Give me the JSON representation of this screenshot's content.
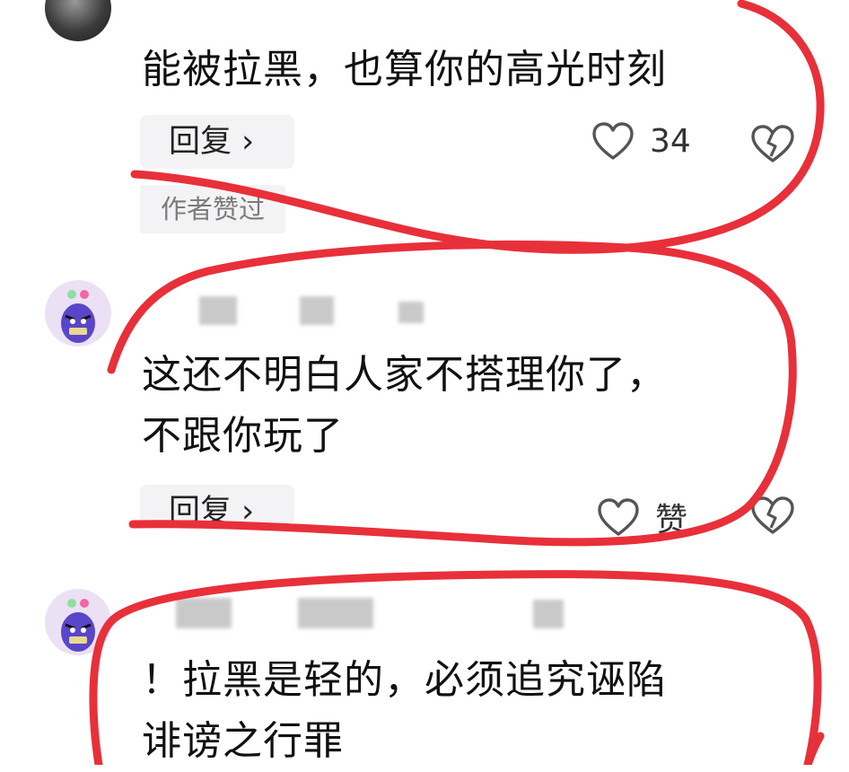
{
  "comments": [
    {
      "text_lines": [
        "能被拉黑，也算你的高光时刻"
      ],
      "reply_label": "回复 ›",
      "like_count": "34",
      "author_badge": "作者赞过"
    },
    {
      "username_partial": "",
      "text_lines": [
        "这还不明白人家不搭理你了，",
        "不跟你玩了"
      ],
      "reply_label": "回复 ›",
      "like_label": "赞"
    },
    {
      "username_partial": "",
      "text_lines": [
        "！拉黑是轻的，必须追究诬陷",
        "诽谤之行罪"
      ]
    }
  ],
  "colors": {
    "annotation_red": "#e8303a",
    "reply_bg": "#f3f3f5",
    "badge_text": "#7b7b7b"
  },
  "icons": [
    "heart-outline-icon",
    "broken-heart-icon"
  ]
}
